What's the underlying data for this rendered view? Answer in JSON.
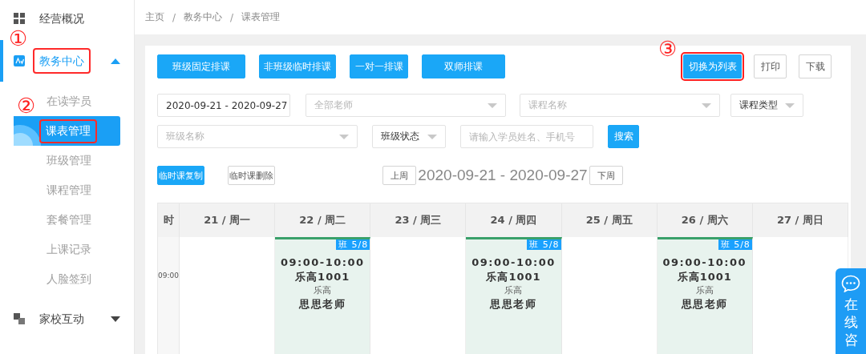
{
  "sidebar": {
    "items": [
      {
        "label": "经营概况",
        "selected": false
      },
      {
        "label": "教务中心",
        "selected": true,
        "expanded": true,
        "highlighted": true,
        "marker": "①",
        "children": [
          {
            "label": "在读学员",
            "selected": false
          },
          {
            "label": "课表管理",
            "selected": true,
            "highlighted": true,
            "marker": "②"
          },
          {
            "label": "班级管理",
            "selected": false
          },
          {
            "label": "课程管理",
            "selected": false
          },
          {
            "label": "套餐管理",
            "selected": false
          },
          {
            "label": "上课记录",
            "selected": false
          },
          {
            "label": "人脸签到",
            "selected": false
          }
        ]
      },
      {
        "label": "家校互动",
        "selected": false,
        "expanded": false
      }
    ]
  },
  "breadcrumb": {
    "separator": "/",
    "items": [
      "主页",
      "教务中心",
      "课表管理"
    ]
  },
  "toolbar": {
    "left": [
      {
        "label": "班级固定排课",
        "kind": "primary"
      },
      {
        "label": "非班级临时排课",
        "kind": "primary"
      },
      {
        "label": "一对一排课",
        "kind": "primary"
      },
      {
        "label": "双师排课",
        "kind": "primary"
      }
    ],
    "right": [
      {
        "label": "切换为列表",
        "kind": "primary",
        "highlighted": true,
        "marker": "③"
      },
      {
        "label": "打印",
        "kind": "default"
      },
      {
        "label": "下载",
        "kind": "default"
      }
    ]
  },
  "filters": [
    [
      {
        "kind": "date",
        "value": "2020-09-21 - 2020-09-27"
      },
      {
        "kind": "select",
        "placeholder": "全部老师"
      },
      {
        "kind": "select",
        "placeholder": "课程名称"
      },
      {
        "kind": "select",
        "value": "课程类型"
      }
    ],
    [
      {
        "kind": "select",
        "placeholder": "班级名称"
      },
      {
        "kind": "select",
        "value": "班级状态"
      },
      {
        "kind": "input",
        "placeholder": "请输入学员姓名、手机号"
      },
      {
        "kind": "button",
        "label": "搜索"
      }
    ]
  ],
  "actions": [
    {
      "label": "临时课复制",
      "kind": "primary"
    },
    {
      "label": "临时课删除",
      "kind": "default"
    }
  ],
  "week_nav": {
    "prev": "上周",
    "range": "2020-09-21 - 2020-09-27",
    "next": "下周"
  },
  "schedule": {
    "time_header": "时",
    "time_slots": [
      {
        "label": "09:00"
      }
    ],
    "days": [
      {
        "label": "21 / 周一"
      },
      {
        "label": "22 / 周二",
        "lesson": {
          "badge": "班 5/8",
          "time": "09:00-10:00",
          "class": "乐高1001",
          "course": "乐高",
          "teacher": "思思老师"
        }
      },
      {
        "label": "23 / 周三"
      },
      {
        "label": "24 / 周四",
        "lesson": {
          "badge": "班 5/8",
          "time": "09:00-10:00",
          "class": "乐高1001",
          "course": "乐高",
          "teacher": "思思老师"
        }
      },
      {
        "label": "25 / 周五"
      },
      {
        "label": "26 / 周六",
        "lesson": {
          "badge": "班 5/8",
          "time": "09:00-10:00",
          "class": "乐高1001",
          "course": "乐高",
          "teacher": "思思老师"
        }
      },
      {
        "label": "27 / 周日"
      }
    ]
  },
  "chat_widget": {
    "label": "在线咨"
  }
}
